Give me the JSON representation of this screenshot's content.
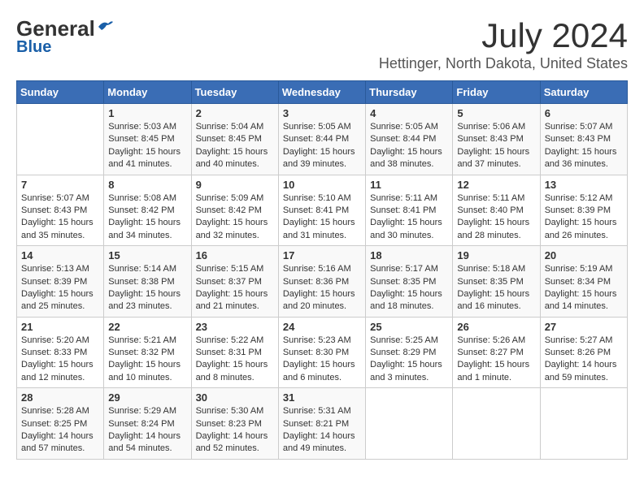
{
  "header": {
    "logo_general": "General",
    "logo_blue": "Blue",
    "month": "July 2024",
    "location": "Hettinger, North Dakota, United States"
  },
  "days_of_week": [
    "Sunday",
    "Monday",
    "Tuesday",
    "Wednesday",
    "Thursday",
    "Friday",
    "Saturday"
  ],
  "weeks": [
    [
      {
        "day": "",
        "info": ""
      },
      {
        "day": "1",
        "info": "Sunrise: 5:03 AM\nSunset: 8:45 PM\nDaylight: 15 hours\nand 41 minutes."
      },
      {
        "day": "2",
        "info": "Sunrise: 5:04 AM\nSunset: 8:45 PM\nDaylight: 15 hours\nand 40 minutes."
      },
      {
        "day": "3",
        "info": "Sunrise: 5:05 AM\nSunset: 8:44 PM\nDaylight: 15 hours\nand 39 minutes."
      },
      {
        "day": "4",
        "info": "Sunrise: 5:05 AM\nSunset: 8:44 PM\nDaylight: 15 hours\nand 38 minutes."
      },
      {
        "day": "5",
        "info": "Sunrise: 5:06 AM\nSunset: 8:43 PM\nDaylight: 15 hours\nand 37 minutes."
      },
      {
        "day": "6",
        "info": "Sunrise: 5:07 AM\nSunset: 8:43 PM\nDaylight: 15 hours\nand 36 minutes."
      }
    ],
    [
      {
        "day": "7",
        "info": "Sunrise: 5:07 AM\nSunset: 8:43 PM\nDaylight: 15 hours\nand 35 minutes."
      },
      {
        "day": "8",
        "info": "Sunrise: 5:08 AM\nSunset: 8:42 PM\nDaylight: 15 hours\nand 34 minutes."
      },
      {
        "day": "9",
        "info": "Sunrise: 5:09 AM\nSunset: 8:42 PM\nDaylight: 15 hours\nand 32 minutes."
      },
      {
        "day": "10",
        "info": "Sunrise: 5:10 AM\nSunset: 8:41 PM\nDaylight: 15 hours\nand 31 minutes."
      },
      {
        "day": "11",
        "info": "Sunrise: 5:11 AM\nSunset: 8:41 PM\nDaylight: 15 hours\nand 30 minutes."
      },
      {
        "day": "12",
        "info": "Sunrise: 5:11 AM\nSunset: 8:40 PM\nDaylight: 15 hours\nand 28 minutes."
      },
      {
        "day": "13",
        "info": "Sunrise: 5:12 AM\nSunset: 8:39 PM\nDaylight: 15 hours\nand 26 minutes."
      }
    ],
    [
      {
        "day": "14",
        "info": "Sunrise: 5:13 AM\nSunset: 8:39 PM\nDaylight: 15 hours\nand 25 minutes."
      },
      {
        "day": "15",
        "info": "Sunrise: 5:14 AM\nSunset: 8:38 PM\nDaylight: 15 hours\nand 23 minutes."
      },
      {
        "day": "16",
        "info": "Sunrise: 5:15 AM\nSunset: 8:37 PM\nDaylight: 15 hours\nand 21 minutes."
      },
      {
        "day": "17",
        "info": "Sunrise: 5:16 AM\nSunset: 8:36 PM\nDaylight: 15 hours\nand 20 minutes."
      },
      {
        "day": "18",
        "info": "Sunrise: 5:17 AM\nSunset: 8:35 PM\nDaylight: 15 hours\nand 18 minutes."
      },
      {
        "day": "19",
        "info": "Sunrise: 5:18 AM\nSunset: 8:35 PM\nDaylight: 15 hours\nand 16 minutes."
      },
      {
        "day": "20",
        "info": "Sunrise: 5:19 AM\nSunset: 8:34 PM\nDaylight: 15 hours\nand 14 minutes."
      }
    ],
    [
      {
        "day": "21",
        "info": "Sunrise: 5:20 AM\nSunset: 8:33 PM\nDaylight: 15 hours\nand 12 minutes."
      },
      {
        "day": "22",
        "info": "Sunrise: 5:21 AM\nSunset: 8:32 PM\nDaylight: 15 hours\nand 10 minutes."
      },
      {
        "day": "23",
        "info": "Sunrise: 5:22 AM\nSunset: 8:31 PM\nDaylight: 15 hours\nand 8 minutes."
      },
      {
        "day": "24",
        "info": "Sunrise: 5:23 AM\nSunset: 8:30 PM\nDaylight: 15 hours\nand 6 minutes."
      },
      {
        "day": "25",
        "info": "Sunrise: 5:25 AM\nSunset: 8:29 PM\nDaylight: 15 hours\nand 3 minutes."
      },
      {
        "day": "26",
        "info": "Sunrise: 5:26 AM\nSunset: 8:27 PM\nDaylight: 15 hours\nand 1 minute."
      },
      {
        "day": "27",
        "info": "Sunrise: 5:27 AM\nSunset: 8:26 PM\nDaylight: 14 hours\nand 59 minutes."
      }
    ],
    [
      {
        "day": "28",
        "info": "Sunrise: 5:28 AM\nSunset: 8:25 PM\nDaylight: 14 hours\nand 57 minutes."
      },
      {
        "day": "29",
        "info": "Sunrise: 5:29 AM\nSunset: 8:24 PM\nDaylight: 14 hours\nand 54 minutes."
      },
      {
        "day": "30",
        "info": "Sunrise: 5:30 AM\nSunset: 8:23 PM\nDaylight: 14 hours\nand 52 minutes."
      },
      {
        "day": "31",
        "info": "Sunrise: 5:31 AM\nSunset: 8:21 PM\nDaylight: 14 hours\nand 49 minutes."
      },
      {
        "day": "",
        "info": ""
      },
      {
        "day": "",
        "info": ""
      },
      {
        "day": "",
        "info": ""
      }
    ]
  ]
}
